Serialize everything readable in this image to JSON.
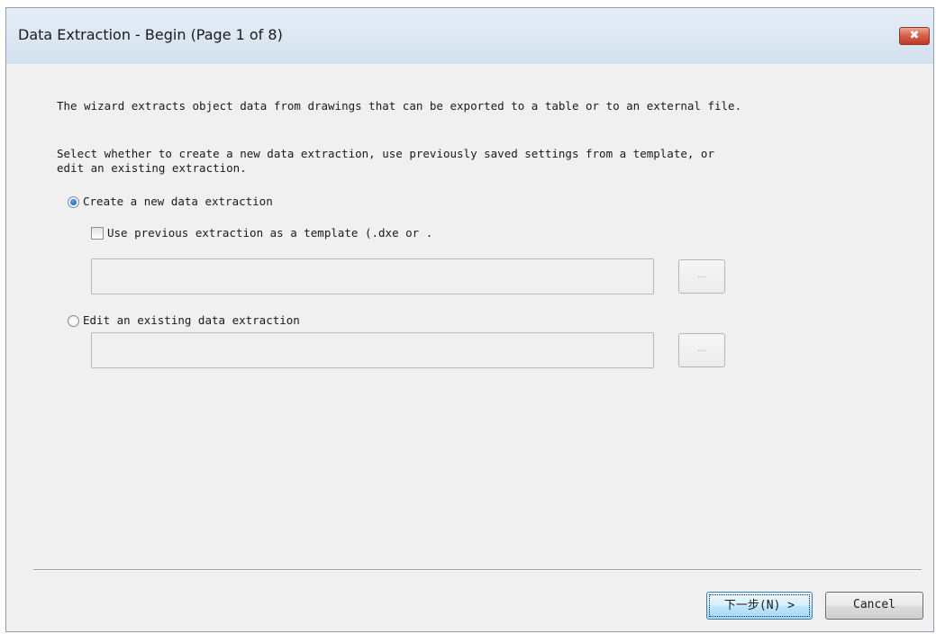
{
  "window": {
    "title": "Data Extraction - Begin (Page 1 of 8)",
    "close_glyph": "✖"
  },
  "intro_text": "The wizard extracts object data from drawings that can be exported to a table or to an external file.",
  "select_text_line1": "Select whether to create a new data extraction, use previously saved settings from a template, or",
  "select_text_line2": "edit an existing extraction.",
  "options": {
    "create_new": {
      "label": "Create a new data extraction",
      "selected": true
    },
    "use_template": {
      "label": "Use previous extraction as a template (.dxe or .",
      "checked": false,
      "path_value": "",
      "browse_label": "..."
    },
    "edit_existing": {
      "label": "Edit an existing data extraction",
      "selected": false,
      "path_value": "",
      "browse_label": "..."
    }
  },
  "buttons": {
    "next": "下一步(N) >",
    "cancel": "Cancel"
  },
  "colors": {
    "titlebar": "#dbe6f2",
    "close": "#c0392b",
    "dialog_bg": "#f0f0f0",
    "default_button_border": "#3c7fb1"
  }
}
